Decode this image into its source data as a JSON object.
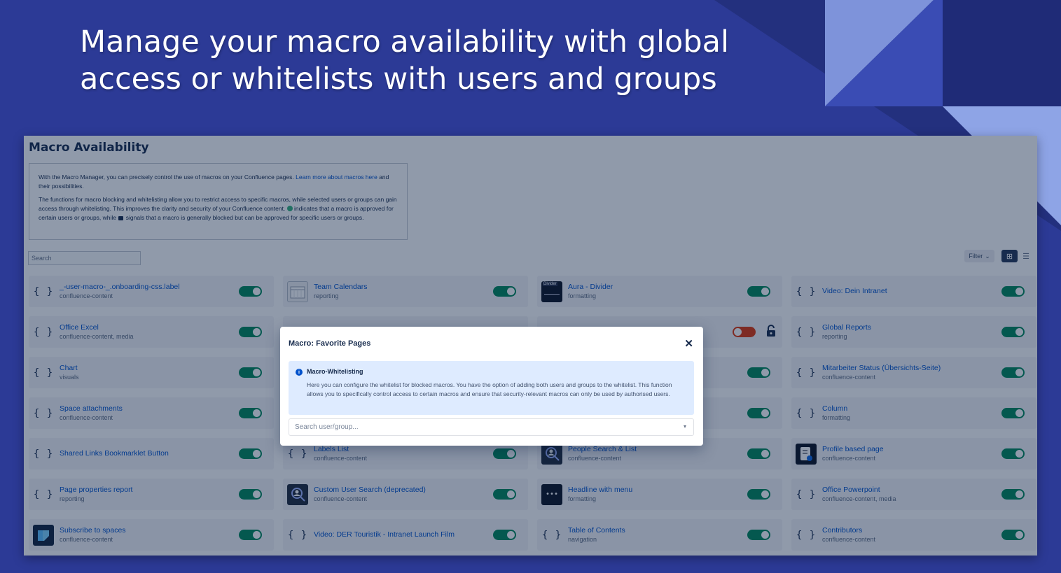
{
  "headline": {
    "line1": "Manage your macro availability with global",
    "line2": "access or whitelists with users and groups"
  },
  "page": {
    "title": "Macro Availability",
    "info": {
      "p1_text": "With the Macro Manager, you can precisely control the use of macros on your Confluence pages.",
      "p1_link": "Learn more about macros here",
      "p1_tail": "and their possibilities.",
      "p2_a": "The functions for macro blocking and whitelisting allow you to restrict access to specific macros, while selected users or groups can gain access through whitelisting. This improves the clarity and security of your Confluence content.",
      "p2_b": "indicates that a macro is approved for certain users or groups, while",
      "p2_c": "signals that a macro is generally blocked but can be approved for specific users or groups."
    },
    "search_placeholder": "Search",
    "filter_label": "Filter",
    "filter_icon": "chevron-down-icon",
    "view_grid_icon": "grid-view-icon",
    "view_list_icon": "list-view-icon"
  },
  "macros": [
    {
      "title": "_-user-macro-_.onboarding-css.label",
      "category": "confluence-content",
      "icon": "braces",
      "enabled": true
    },
    {
      "title": "Team Calendars",
      "category": "reporting",
      "icon": "calendar",
      "enabled": true
    },
    {
      "title": "Aura - Divider",
      "category": "formatting",
      "icon": "divider",
      "enabled": true
    },
    {
      "title": "Video: Dein Intranet",
      "category": "",
      "icon": "braces",
      "enabled": true
    },
    {
      "title": "Office Excel",
      "category": "confluence-content, media",
      "icon": "braces",
      "enabled": true
    },
    {
      "title": "",
      "category": "",
      "icon": "hidden",
      "enabled": true
    },
    {
      "title": "",
      "category": "",
      "icon": "hidden",
      "enabled": false,
      "locked": true
    },
    {
      "title": "Global Reports",
      "category": "reporting",
      "icon": "braces",
      "enabled": true
    },
    {
      "title": "Chart",
      "category": "visuals",
      "icon": "braces",
      "enabled": true
    },
    {
      "title": "",
      "category": "",
      "icon": "hidden",
      "enabled": true
    },
    {
      "title": "",
      "category": "",
      "icon": "hidden",
      "enabled": true
    },
    {
      "title": "Mitarbeiter Status (Übersichts-Seite)",
      "category": "confluence-content",
      "icon": "braces",
      "enabled": true
    },
    {
      "title": "Space attachments",
      "category": "confluence-content",
      "icon": "braces",
      "enabled": true
    },
    {
      "title": "",
      "category": "",
      "icon": "hidden",
      "enabled": true
    },
    {
      "title": "",
      "category": "",
      "icon": "hidden",
      "enabled": true
    },
    {
      "title": "Column",
      "category": "formatting",
      "icon": "braces",
      "enabled": true
    },
    {
      "title": "Shared Links Bookmarklet Button",
      "category": "",
      "icon": "braces",
      "enabled": true
    },
    {
      "title": "Labels List",
      "category": "confluence-content",
      "icon": "braces",
      "enabled": true
    },
    {
      "title": "People Search & List",
      "category": "confluence-content",
      "icon": "people-search",
      "enabled": true
    },
    {
      "title": "Profile based page",
      "category": "confluence-content",
      "icon": "profile-page",
      "enabled": true
    },
    {
      "title": "Page properties report",
      "category": "reporting",
      "icon": "braces",
      "enabled": true
    },
    {
      "title": "Custom User Search (deprecated)",
      "category": "confluence-content",
      "icon": "people-search",
      "enabled": true
    },
    {
      "title": "Headline with menu",
      "category": "formatting",
      "icon": "headline-menu",
      "enabled": true
    },
    {
      "title": "Office Powerpoint",
      "category": "confluence-content, media",
      "icon": "braces",
      "enabled": true
    },
    {
      "title": "Subscribe to spaces",
      "category": "confluence-content",
      "icon": "spaces",
      "enabled": true
    },
    {
      "title": "Video: DER Touristik - Intranet Launch Film",
      "category": "",
      "icon": "braces",
      "enabled": true
    },
    {
      "title": "Table of Contents",
      "category": "navigation",
      "icon": "braces",
      "enabled": true
    },
    {
      "title": "Contributors",
      "category": "confluence-content",
      "icon": "braces",
      "enabled": true
    }
  ],
  "modal": {
    "title": "Macro: Favorite Pages",
    "close_icon": "close-icon",
    "notice_title": "Macro-Whitelisting",
    "notice_text": "Here you can configure the whitelist for blocked macros. You have the option of adding both users and groups to the whitelist. This function allows you to specifically control access to certain macros and ensure that security-relevant macros can only be used by authorised users.",
    "search_placeholder": "Search user/group..."
  },
  "colors": {
    "background": "#2c3a96",
    "toggle_on": "#00875a",
    "toggle_off": "#de350b",
    "link": "#0052cc"
  }
}
